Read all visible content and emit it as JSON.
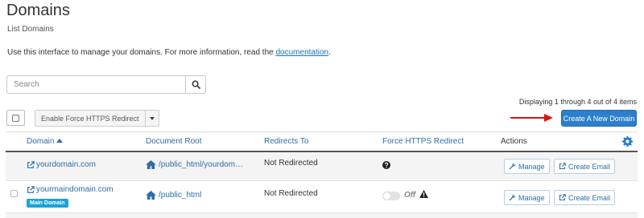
{
  "header": {
    "title": "Domains",
    "subtitle": "List Domains",
    "intro_text": "Use this interface to manage your domains. For more information, read the ",
    "intro_link": "documentation",
    "intro_end": "."
  },
  "search": {
    "placeholder": "Search",
    "value": ""
  },
  "toolbar": {
    "https_button_label": "Enable Force HTTPS Redirect",
    "create_button_label": "Create A New Domain",
    "displaying_text": "Displaying 1 through 4 out of 4 items"
  },
  "table": {
    "columns": {
      "domain": "Domain",
      "document_root": "Document Root",
      "redirects_to": "Redirects To",
      "force_https": "Force HTTPS Redirect",
      "actions": "Actions"
    },
    "rows": [
      {
        "domain": "yourdomain.com",
        "document_root": "/public_html/yourdomain.com",
        "redirects_to": "Not Redirected",
        "force_https_icon": "question-circle-icon",
        "manage_label": "Manage",
        "create_email_label": "Create Email"
      },
      {
        "domain": "yourmaindomain.com",
        "badge": "Main Domain",
        "document_root": "/public_html",
        "redirects_to": "Not Redirected",
        "force_https_state": "Off",
        "force_https_icon": "warning-icon",
        "manage_label": "Manage",
        "create_email_label": "Create Email"
      }
    ]
  },
  "colors": {
    "primary_button": "#2d7fcc",
    "link": "#2d6ea8",
    "badge": "#1ba3d6",
    "annotation_arrow": "#d91515"
  }
}
